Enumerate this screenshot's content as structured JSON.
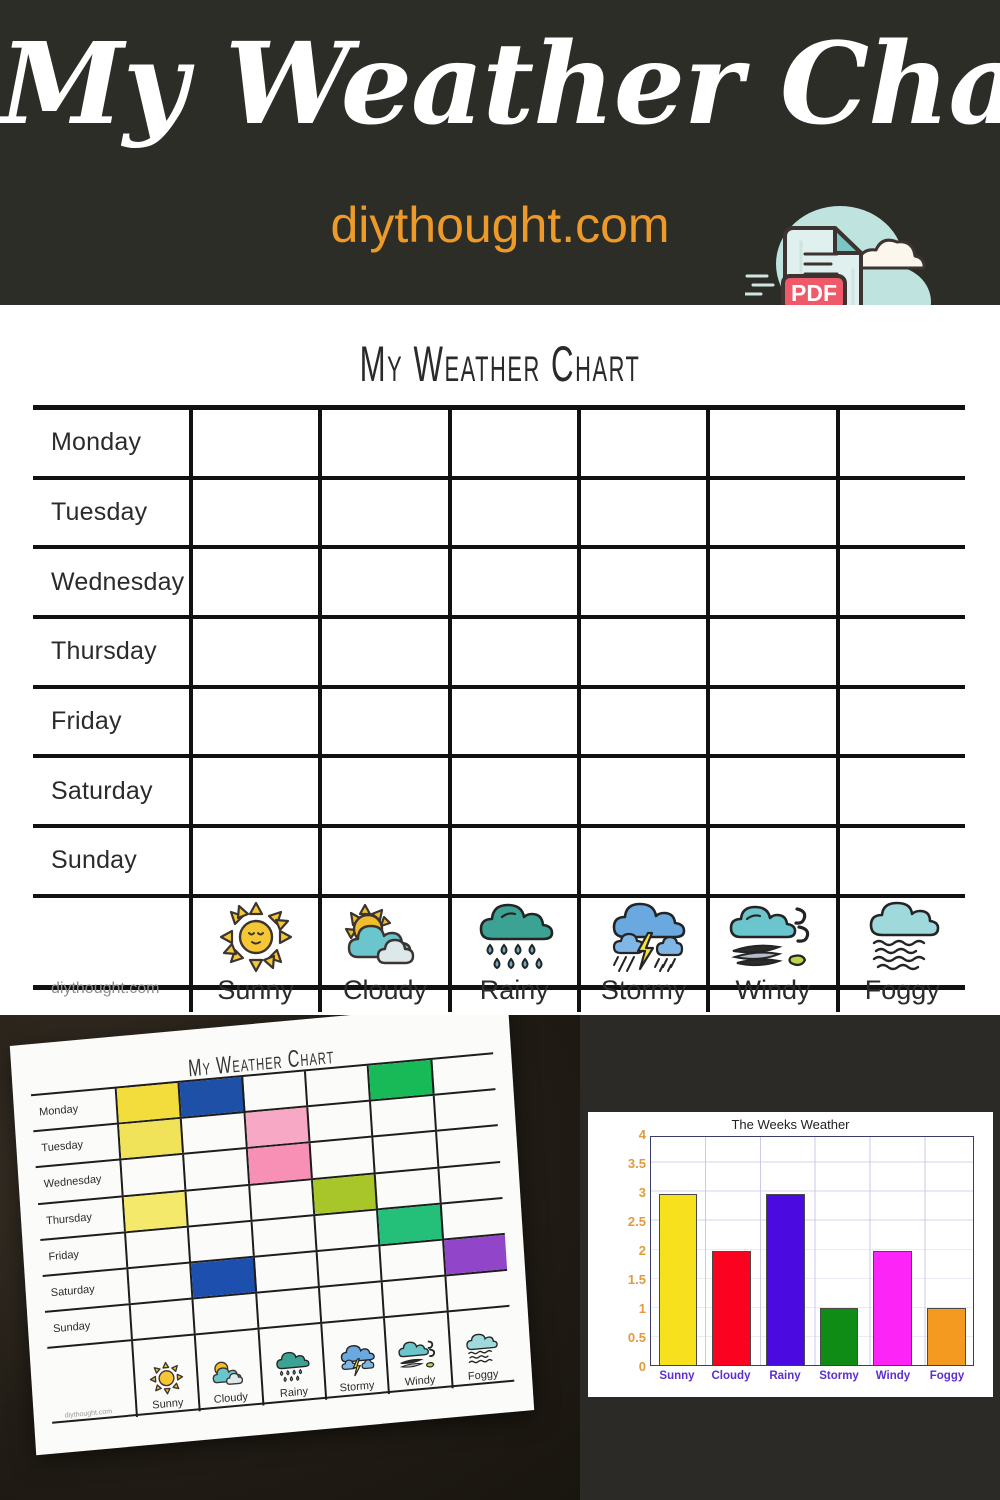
{
  "banner": {
    "title": "My Weather Chart",
    "site": "diythought.com",
    "pdf_badge": "PDF"
  },
  "printable": {
    "title": "My Weather Chart",
    "watermark": "diythought.com",
    "days": [
      "Monday",
      "Tuesday",
      "Wednesday",
      "Thursday",
      "Friday",
      "Saturday",
      "Sunday"
    ],
    "weather": [
      {
        "name": "Sunny",
        "icon": "sun-icon"
      },
      {
        "name": "Cloudy",
        "icon": "sun-behind-cloud-icon"
      },
      {
        "name": "Rainy",
        "icon": "rain-cloud-icon"
      },
      {
        "name": "Stormy",
        "icon": "thunderstorm-icon"
      },
      {
        "name": "Windy",
        "icon": "wind-cloud-icon"
      },
      {
        "name": "Foggy",
        "icon": "fog-cloud-icon"
      }
    ]
  },
  "photo": {
    "title": "My Weather Chart",
    "watermark": "diythought.com",
    "days": [
      "Monday",
      "Tuesday",
      "Wednesday",
      "Thursday",
      "Friday",
      "Saturday",
      "Sunday"
    ],
    "weather": [
      "Sunny",
      "Cloudy",
      "Rainy",
      "Stormy",
      "Windy",
      "Foggy"
    ],
    "filled_cells": [
      {
        "day": "Monday",
        "weather": "Sunny",
        "color": "#f2dd3d"
      },
      {
        "day": "Monday",
        "weather": "Cloudy",
        "color": "#1f50a8"
      },
      {
        "day": "Monday",
        "weather": "Windy",
        "color": "#18ba58"
      },
      {
        "day": "Tuesday",
        "weather": "Sunny",
        "color": "#f0e35a"
      },
      {
        "day": "Tuesday",
        "weather": "Rainy",
        "color": "#f7a8c4"
      },
      {
        "day": "Wednesday",
        "weather": "Rainy",
        "color": "#f890b6"
      },
      {
        "day": "Thursday",
        "weather": "Sunny",
        "color": "#f5e96b"
      },
      {
        "day": "Thursday",
        "weather": "Stormy",
        "color": "#a8c62a"
      },
      {
        "day": "Friday",
        "weather": "Windy",
        "color": "#24c07a"
      },
      {
        "day": "Saturday",
        "weather": "Cloudy",
        "color": "#1c4fae"
      },
      {
        "day": "Saturday",
        "weather": "Foggy",
        "color": "#9145c9"
      }
    ]
  },
  "chart_data": {
    "type": "bar",
    "title": "The Weeks Weather",
    "xlabel": "",
    "ylabel": "",
    "categories": [
      "Sunny",
      "Cloudy",
      "Rainy",
      "Stormy",
      "Windy",
      "Foggy"
    ],
    "values": [
      3,
      2,
      3,
      1,
      2,
      1
    ],
    "colors": [
      "#f7e01d",
      "#fb0220",
      "#4b0be0",
      "#0f8c16",
      "#fd24f7",
      "#f59a20"
    ],
    "ylim": [
      0,
      4
    ],
    "yticks": [
      "0",
      "0.5",
      "1",
      "1.5",
      "2",
      "2.5",
      "3",
      "3.5",
      "4"
    ],
    "ytick_color": "#e29a3c",
    "xtick_color": "#5b2fd0",
    "grid": true,
    "legend": "none"
  }
}
